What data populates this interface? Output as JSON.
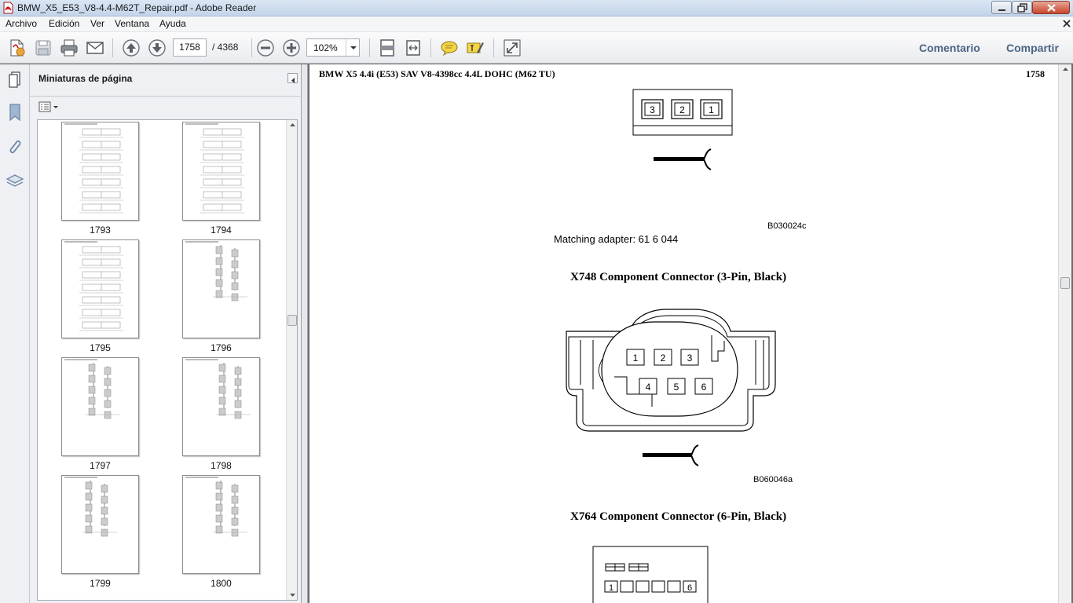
{
  "window": {
    "title": "BMW_X5_E53_V8-4.4-M62T_Repair.pdf - Adobe Reader"
  },
  "menu": {
    "items": [
      "Archivo",
      "Edición",
      "Ver",
      "Ventana",
      "Ayuda"
    ]
  },
  "toolbar": {
    "current_page": "1758",
    "total_pages": "/  4368",
    "zoom": "102%",
    "comment_label": "Comentario",
    "share_label": "Compartir"
  },
  "icons": {
    "create": "create-pdf-icon",
    "save": "save-icon",
    "print": "print-icon",
    "email": "email-icon",
    "prev": "previous-page-icon",
    "next": "next-page-icon",
    "zoom_out": "zoom-out-icon",
    "zoom_in": "zoom-in-icon",
    "fit_page": "fit-page-icon",
    "fit_width": "fit-width-icon",
    "comment": "sticky-note-icon",
    "highlight": "highlight-icon",
    "fullscreen": "expand-icon"
  },
  "sidebar": {
    "title": "Miniaturas de página",
    "thumbnails": [
      {
        "label": "1793"
      },
      {
        "label": "1794"
      },
      {
        "label": "1795"
      },
      {
        "label": "1796"
      },
      {
        "label": "1797"
      },
      {
        "label": "1798"
      },
      {
        "label": "1799"
      },
      {
        "label": "1800"
      }
    ]
  },
  "document": {
    "header": "BMW X5 4.4i (E53) SAV V8-4398cc 4.4L DOHC (M62 TU)",
    "page_number": "1758",
    "figure1_code": "B030024c",
    "matching_adapter": "Matching adapter: 61 6 044",
    "x748_title": "X748 Component Connector (3-Pin, Black)",
    "figure2_code": "B060046a",
    "x764_title": "X764 Component Connector (6-Pin, Black)",
    "connector1_pins": [
      "3",
      "2",
      "1"
    ],
    "connector2_pins": [
      "1",
      "2",
      "3",
      "4",
      "5",
      "6"
    ],
    "connector3_pins": [
      "1",
      "6"
    ]
  },
  "colors": {
    "accent": "#4a6586",
    "background": "#6b6b6b"
  }
}
